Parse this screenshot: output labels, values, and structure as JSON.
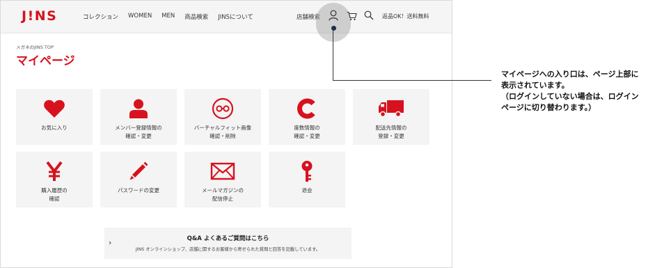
{
  "header": {
    "logo": "J!NS",
    "nav": [
      "コレクション",
      "WOMEN",
      "MEN",
      "商品検索",
      "JINSについて"
    ],
    "store_search": "店舗検索",
    "promo": "返品OK！送料無料",
    "icons": [
      "user-icon",
      "cart-icon",
      "search-icon"
    ]
  },
  "breadcrumb": "メガネのJINS TOP",
  "page_title": "マイページ",
  "tiles": [
    {
      "label": "お気に入り",
      "icon": "heart-icon"
    },
    {
      "label": "メンバー登録情報の\n確認・変更",
      "icon": "person-icon"
    },
    {
      "label": "バーチャルフィット画像\n確認・削除",
      "icon": "glasses-icon"
    },
    {
      "label": "度数情報の\n確認・変更",
      "icon": "c-icon"
    },
    {
      "label": "配送先情報の\n登録・変更",
      "icon": "truck-icon"
    },
    {
      "label": "購入履歴の\n確認",
      "icon": "yen-icon"
    },
    {
      "label": "パスワードの変更",
      "icon": "pencil-icon"
    },
    {
      "label": "メールマガジンの\n配信停止",
      "icon": "envelope-icon"
    },
    {
      "label": "退会",
      "icon": "key-icon"
    }
  ],
  "faq": {
    "title": "Q&A よくあるご質問はこちら",
    "subtitle": "JINS オンラインショップ、店舗に関するお客様から寄せられた質問と回答を記載しています。",
    "chevron": "›"
  },
  "callout": {
    "lines": [
      "マイページへの入り口は、ページ上部に",
      "表示されています。",
      "（ログインしていない場合は、ログイン",
      "ページに切り替わります。）"
    ]
  },
  "colors": {
    "accent": "#d7121e",
    "marker": "#1f2b4d"
  }
}
